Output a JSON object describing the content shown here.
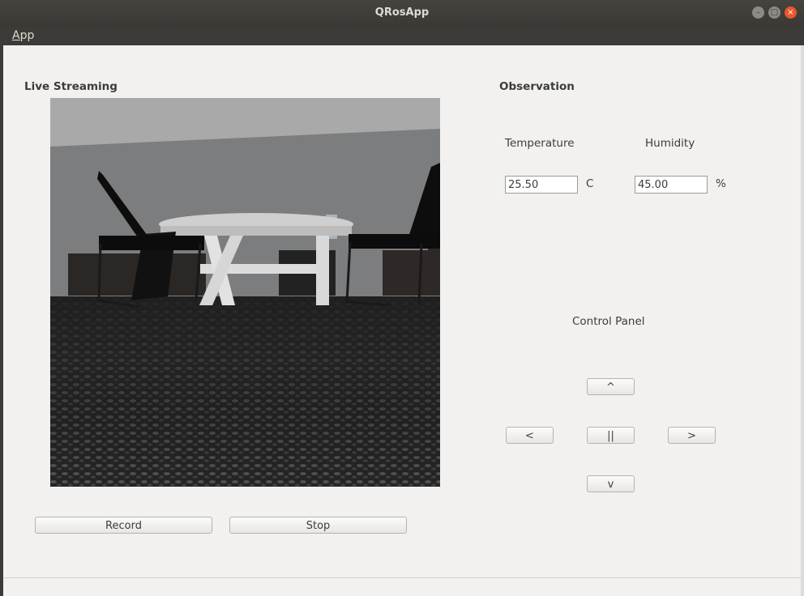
{
  "window": {
    "title": "QRosApp"
  },
  "menu": {
    "app_prefix": "A",
    "app_rest": "pp"
  },
  "streaming": {
    "heading": "Live Streaming",
    "record_label": "Record",
    "stop_label": "Stop"
  },
  "observation": {
    "heading": "Observation",
    "temperature_label": "Temperature",
    "temperature_value": "25.50",
    "temperature_unit": "C",
    "humidity_label": "Humidity",
    "humidity_value": "45.00",
    "humidity_unit": "%"
  },
  "control_panel": {
    "label": "Control Panel",
    "up_label": "^",
    "left_label": "<",
    "stop_label": "||",
    "right_label": ">",
    "down_label": "v"
  },
  "window_buttons": {
    "minimize": "–",
    "maximize": "□",
    "close": "×"
  },
  "colors": {
    "titlebar": "#3c3b37",
    "client": "#f2f1f0",
    "close_button": "#e9572b"
  }
}
